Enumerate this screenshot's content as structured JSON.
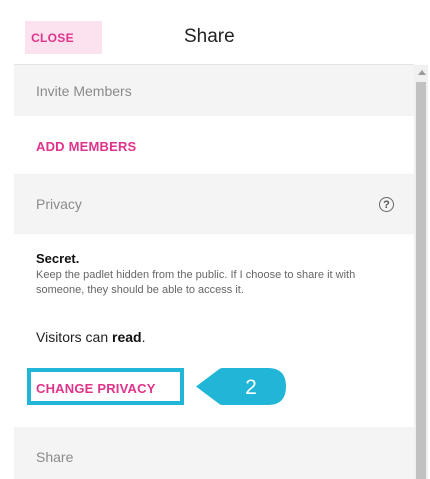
{
  "header": {
    "close_label": "CLOSE",
    "title": "Share"
  },
  "invite": {
    "heading": "Invite Members",
    "add_members_label": "ADD MEMBERS"
  },
  "privacy": {
    "heading": "Privacy",
    "help_glyph": "?",
    "level_title": "Secret.",
    "level_description": "Keep the padlet hidden from the public. If I choose to share it with someone, they should be able to access it.",
    "visitors_prefix": "Visitors can ",
    "visitors_permission": "read",
    "visitors_suffix": ".",
    "change_label": "CHANGE PRIVACY"
  },
  "share": {
    "heading": "Share"
  },
  "annotation": {
    "step_number": "2",
    "color": "#21b5d7"
  },
  "colors": {
    "accent": "#e0338b",
    "section_bg": "#f4f4f4",
    "highlight": "#21b5d7"
  }
}
